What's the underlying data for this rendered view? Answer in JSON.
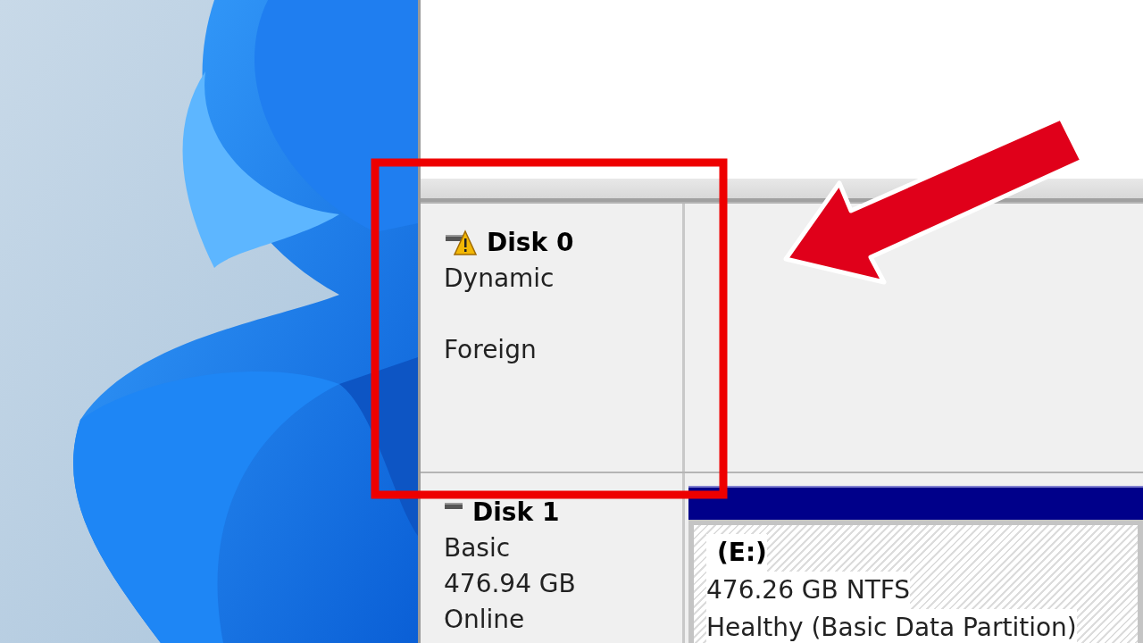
{
  "disks": [
    {
      "name": "Disk 0",
      "warning": true,
      "type": "Dynamic",
      "status": "Foreign"
    },
    {
      "name": "Disk 1",
      "warning": false,
      "type": "Basic",
      "size": "476.94 GB",
      "status": "Online",
      "partitions": [
        {
          "label": "(E:)",
          "size": "476.26 GB NTFS",
          "status": "Healthy (Basic Data Partition)"
        }
      ]
    }
  ]
}
